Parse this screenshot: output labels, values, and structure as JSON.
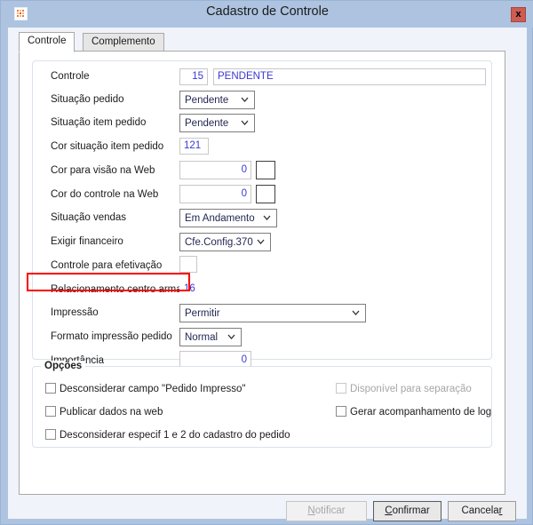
{
  "window": {
    "title": "Cadastro de Controle",
    "app_icon": "app-icon",
    "close_label": "x",
    "chrome_color": "#adc3e0",
    "close_color": "#cd5c52"
  },
  "tabs": [
    {
      "label": "Controle",
      "active": true
    },
    {
      "label": "Complemento",
      "active": false
    }
  ],
  "form": {
    "fields": [
      {
        "label": "Controle",
        "value": "15",
        "value2": "PENDENTE"
      },
      {
        "label": "Situação pedido",
        "value": "Pendente"
      },
      {
        "label": "Situação item pedido",
        "value": "Pendente"
      },
      {
        "label": "Cor situação item pedido",
        "value": "121"
      },
      {
        "label": "Cor para visão na Web",
        "value": "0"
      },
      {
        "label": "Cor do controle na Web",
        "value": "0"
      },
      {
        "label": "Situação vendas",
        "value": "Em Andamento"
      },
      {
        "label": "Exigir financeiro",
        "value": "Cfe.Config.370"
      },
      {
        "label": "Controle para efetivação",
        "value": ""
      },
      {
        "label": "Relacionamento centro armaz.",
        "value": "16"
      },
      {
        "label": "Impressão",
        "value": "Permitir"
      },
      {
        "label": "Formato impressão pedido",
        "value": "Normal"
      },
      {
        "label": "Importância",
        "value": "0"
      }
    ]
  },
  "options": {
    "legend": "Opções",
    "left": [
      {
        "label": "Desconsiderar campo \"Pedido Impresso\"",
        "checked": false,
        "disabled": false
      },
      {
        "label": "Publicar dados na web",
        "checked": false,
        "disabled": false
      },
      {
        "label": "Desconsiderar especif 1 e 2 do cadastro do pedido",
        "checked": false,
        "disabled": false
      }
    ],
    "right": [
      {
        "label": "Disponível para separação",
        "checked": false,
        "disabled": true
      },
      {
        "label": "Gerar acompanhamento de log",
        "checked": false,
        "disabled": false
      }
    ]
  },
  "buttons": {
    "notificar": {
      "label": "Notificar",
      "mnemonic": "N",
      "disabled": true
    },
    "confirmar": {
      "label": "Confirmar",
      "mnemonic": "C",
      "default": true
    },
    "cancelar": {
      "label": "Cancelar",
      "mnemonic": "r",
      "default": false
    }
  },
  "annotation": {
    "color": "#f80000",
    "target_label": "Relacionamento centro armaz.",
    "target_value": "16"
  }
}
